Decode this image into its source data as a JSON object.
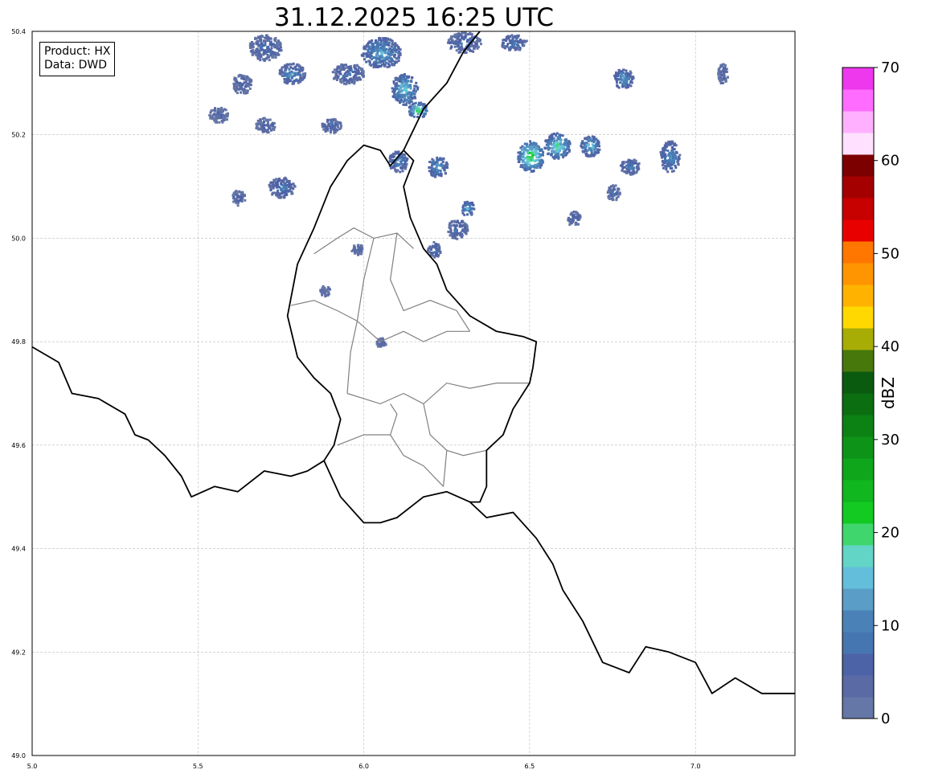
{
  "title": "31.12.2025 16:25 UTC",
  "info": {
    "product": "Product: HX",
    "data": "Data: DWD"
  },
  "map": {
    "lon_range": [
      5.0,
      7.3
    ],
    "lat_range": [
      49.0,
      50.4
    ],
    "x_ticks": [
      "5.0",
      "5.5",
      "6.0",
      "6.5",
      "7.0"
    ],
    "y_ticks": [
      "49.0",
      "49.2",
      "49.4",
      "49.6",
      "49.8",
      "50.0",
      "50.2",
      "50.4"
    ],
    "grid": true,
    "border_color": "#000000",
    "district_color": "#808080"
  },
  "colorbar": {
    "label": "dBZ",
    "range": [
      0,
      70
    ],
    "tick_labels": [
      "0",
      "10",
      "20",
      "30",
      "40",
      "50",
      "60",
      "70"
    ],
    "colors": [
      "#6477a6",
      "#5a6aa5",
      "#4c63a7",
      "#4676b1",
      "#4a82b8",
      "#5a9dc7",
      "#63bedc",
      "#62d5c6",
      "#40d66e",
      "#12ca22",
      "#10b71e",
      "#0fa61b",
      "#0d9418",
      "#0c8215",
      "#0b6f12",
      "#0a5b0f",
      "#46780c",
      "#a8ad06",
      "#fed800",
      "#ffb300",
      "#ff9500",
      "#ff7700",
      "#e80000",
      "#c70000",
      "#a50000",
      "#7c0000",
      "#ffe1ff",
      "#ffb1ff",
      "#ff6cff",
      "#ed38ed"
    ]
  },
  "echo_cells": [
    {
      "lon": 5.7,
      "lat": 50.37,
      "rx": 0.05,
      "ry": 0.025,
      "dbz": 8
    },
    {
      "lon": 5.63,
      "lat": 50.3,
      "rx": 0.03,
      "ry": 0.02,
      "dbz": 6
    },
    {
      "lon": 5.78,
      "lat": 50.32,
      "rx": 0.04,
      "ry": 0.02,
      "dbz": 12
    },
    {
      "lon": 5.56,
      "lat": 50.24,
      "rx": 0.03,
      "ry": 0.015,
      "dbz": 5
    },
    {
      "lon": 5.7,
      "lat": 50.22,
      "rx": 0.03,
      "ry": 0.015,
      "dbz": 6
    },
    {
      "lon": 5.75,
      "lat": 50.1,
      "rx": 0.04,
      "ry": 0.02,
      "dbz": 10
    },
    {
      "lon": 5.62,
      "lat": 50.08,
      "rx": 0.02,
      "ry": 0.015,
      "dbz": 6
    },
    {
      "lon": 5.95,
      "lat": 50.32,
      "rx": 0.05,
      "ry": 0.02,
      "dbz": 8
    },
    {
      "lon": 6.05,
      "lat": 50.36,
      "rx": 0.06,
      "ry": 0.03,
      "dbz": 14
    },
    {
      "lon": 6.12,
      "lat": 50.29,
      "rx": 0.04,
      "ry": 0.03,
      "dbz": 17
    },
    {
      "lon": 6.16,
      "lat": 50.25,
      "rx": 0.03,
      "ry": 0.015,
      "dbz": 22
    },
    {
      "lon": 6.1,
      "lat": 50.15,
      "rx": 0.03,
      "ry": 0.02,
      "dbz": 12
    },
    {
      "lon": 6.22,
      "lat": 50.14,
      "rx": 0.03,
      "ry": 0.02,
      "dbz": 14
    },
    {
      "lon": 5.9,
      "lat": 50.22,
      "rx": 0.03,
      "ry": 0.015,
      "dbz": 8
    },
    {
      "lon": 6.3,
      "lat": 50.38,
      "rx": 0.05,
      "ry": 0.02,
      "dbz": 9
    },
    {
      "lon": 6.28,
      "lat": 50.02,
      "rx": 0.03,
      "ry": 0.02,
      "dbz": 8
    },
    {
      "lon": 6.31,
      "lat": 50.06,
      "rx": 0.02,
      "ry": 0.015,
      "dbz": 15
    },
    {
      "lon": 6.21,
      "lat": 49.98,
      "rx": 0.02,
      "ry": 0.015,
      "dbz": 9
    },
    {
      "lon": 6.5,
      "lat": 50.16,
      "rx": 0.04,
      "ry": 0.03,
      "dbz": 24
    },
    {
      "lon": 6.58,
      "lat": 50.18,
      "rx": 0.04,
      "ry": 0.025,
      "dbz": 20
    },
    {
      "lon": 6.68,
      "lat": 50.18,
      "rx": 0.03,
      "ry": 0.02,
      "dbz": 16
    },
    {
      "lon": 6.78,
      "lat": 50.31,
      "rx": 0.03,
      "ry": 0.02,
      "dbz": 14
    },
    {
      "lon": 6.92,
      "lat": 50.16,
      "rx": 0.03,
      "ry": 0.03,
      "dbz": 12
    },
    {
      "lon": 6.75,
      "lat": 50.09,
      "rx": 0.02,
      "ry": 0.015,
      "dbz": 8
    },
    {
      "lon": 6.63,
      "lat": 50.04,
      "rx": 0.02,
      "ry": 0.015,
      "dbz": 7
    },
    {
      "lon": 6.8,
      "lat": 50.14,
      "rx": 0.03,
      "ry": 0.015,
      "dbz": 10
    },
    {
      "lon": 7.08,
      "lat": 50.32,
      "rx": 0.015,
      "ry": 0.02,
      "dbz": 6
    },
    {
      "lon": 6.45,
      "lat": 50.38,
      "rx": 0.04,
      "ry": 0.015,
      "dbz": 10
    },
    {
      "lon": 5.98,
      "lat": 49.98,
      "rx": 0.02,
      "ry": 0.01,
      "dbz": 6
    },
    {
      "lon": 5.88,
      "lat": 49.9,
      "rx": 0.015,
      "ry": 0.01,
      "dbz": 5
    },
    {
      "lon": 6.05,
      "lat": 49.8,
      "rx": 0.015,
      "ry": 0.01,
      "dbz": 6
    }
  ],
  "borders": [
    [
      [
        5.0,
        49.79
      ],
      [
        5.08,
        49.76
      ],
      [
        5.12,
        49.7
      ],
      [
        5.2,
        49.69
      ],
      [
        5.28,
        49.66
      ],
      [
        5.31,
        49.62
      ],
      [
        5.35,
        49.61
      ],
      [
        5.4,
        49.58
      ],
      [
        5.45,
        49.54
      ],
      [
        5.48,
        49.5
      ],
      [
        5.55,
        49.52
      ],
      [
        5.62,
        49.51
      ],
      [
        5.7,
        49.55
      ],
      [
        5.78,
        49.54
      ],
      [
        5.83,
        49.55
      ],
      [
        5.88,
        49.57
      ],
      [
        5.93,
        49.5
      ],
      [
        6.0,
        49.45
      ],
      [
        6.05,
        49.45
      ],
      [
        6.1,
        49.46
      ],
      [
        6.18,
        49.5
      ],
      [
        6.25,
        49.51
      ],
      [
        6.32,
        49.49
      ],
      [
        6.37,
        49.46
      ],
      [
        6.45,
        49.47
      ],
      [
        6.52,
        49.42
      ],
      [
        6.57,
        49.37
      ],
      [
        6.6,
        49.32
      ],
      [
        6.66,
        49.26
      ],
      [
        6.72,
        49.18
      ],
      [
        6.8,
        49.16
      ],
      [
        6.85,
        49.21
      ],
      [
        6.92,
        49.2
      ],
      [
        7.0,
        49.18
      ],
      [
        7.05,
        49.12
      ],
      [
        7.12,
        49.15
      ],
      [
        7.2,
        49.12
      ],
      [
        7.3,
        49.12
      ]
    ],
    [
      [
        5.88,
        49.57
      ],
      [
        5.91,
        49.6
      ],
      [
        5.93,
        49.65
      ],
      [
        5.9,
        49.7
      ],
      [
        5.85,
        49.73
      ],
      [
        5.8,
        49.77
      ],
      [
        5.77,
        49.85
      ],
      [
        5.8,
        49.95
      ],
      [
        5.85,
        50.02
      ],
      [
        5.9,
        50.1
      ],
      [
        5.95,
        50.15
      ],
      [
        6.0,
        50.18
      ],
      [
        6.05,
        50.17
      ],
      [
        6.08,
        50.14
      ],
      [
        6.12,
        50.17
      ],
      [
        6.15,
        50.15
      ],
      [
        6.12,
        50.1
      ],
      [
        6.14,
        50.04
      ],
      [
        6.18,
        49.98
      ],
      [
        6.22,
        49.95
      ],
      [
        6.25,
        49.9
      ],
      [
        6.32,
        49.85
      ],
      [
        6.4,
        49.82
      ],
      [
        6.48,
        49.81
      ],
      [
        6.52,
        49.8
      ],
      [
        6.51,
        49.75
      ],
      [
        6.5,
        49.72
      ],
      [
        6.45,
        49.67
      ],
      [
        6.42,
        49.62
      ],
      [
        6.37,
        49.59
      ],
      [
        6.37,
        49.52
      ],
      [
        6.35,
        49.49
      ],
      [
        6.32,
        49.49
      ]
    ],
    [
      [
        6.12,
        50.17
      ],
      [
        6.18,
        50.25
      ],
      [
        6.25,
        50.3
      ],
      [
        6.3,
        50.36
      ],
      [
        6.35,
        50.4
      ]
    ]
  ],
  "districts": [
    [
      [
        5.85,
        49.97
      ],
      [
        5.92,
        50.0
      ],
      [
        5.97,
        50.02
      ],
      [
        6.03,
        50.0
      ],
      [
        6.1,
        50.01
      ],
      [
        6.15,
        49.98
      ]
    ],
    [
      [
        6.03,
        50.0
      ],
      [
        6.0,
        49.92
      ],
      [
        5.98,
        49.84
      ],
      [
        5.96,
        49.78
      ],
      [
        5.95,
        49.7
      ]
    ],
    [
      [
        5.78,
        49.87
      ],
      [
        5.85,
        49.88
      ],
      [
        5.92,
        49.86
      ],
      [
        5.98,
        49.84
      ]
    ],
    [
      [
        5.98,
        49.84
      ],
      [
        6.05,
        49.8
      ],
      [
        6.12,
        49.82
      ],
      [
        6.18,
        49.8
      ],
      [
        6.25,
        49.82
      ],
      [
        6.32,
        49.82
      ]
    ],
    [
      [
        6.1,
        50.01
      ],
      [
        6.08,
        49.92
      ],
      [
        6.12,
        49.86
      ],
      [
        6.2,
        49.88
      ],
      [
        6.28,
        49.86
      ],
      [
        6.32,
        49.82
      ]
    ],
    [
      [
        5.95,
        49.7
      ],
      [
        6.05,
        49.68
      ],
      [
        6.12,
        49.7
      ],
      [
        6.18,
        49.68
      ],
      [
        6.25,
        49.72
      ],
      [
        6.32,
        49.71
      ],
      [
        6.4,
        49.72
      ],
      [
        6.5,
        49.72
      ]
    ],
    [
      [
        6.18,
        49.68
      ],
      [
        6.2,
        49.62
      ],
      [
        6.25,
        49.59
      ],
      [
        6.3,
        49.58
      ],
      [
        6.37,
        49.59
      ]
    ],
    [
      [
        5.92,
        49.6
      ],
      [
        6.0,
        49.62
      ],
      [
        6.08,
        49.62
      ],
      [
        6.12,
        49.58
      ],
      [
        6.18,
        49.56
      ],
      [
        6.24,
        49.52
      ]
    ],
    [
      [
        6.08,
        49.62
      ],
      [
        6.1,
        49.66
      ],
      [
        6.08,
        49.68
      ]
    ],
    [
      [
        6.25,
        49.59
      ],
      [
        6.24,
        49.52
      ]
    ]
  ]
}
